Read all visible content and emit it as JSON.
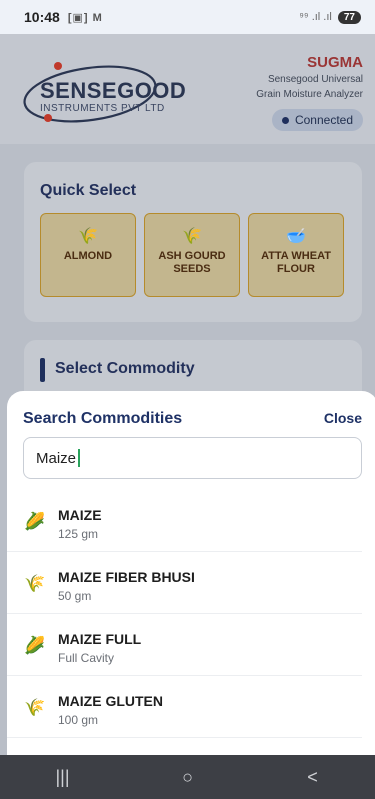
{
  "status_bar": {
    "time": "10:48",
    "left_icons": "[▣] M",
    "right_icons": "⁹⁹ .ıl .ıl",
    "battery": "77"
  },
  "header": {
    "brand": "SENSEGOOD",
    "brand_sub": "INSTRUMENTS PVT LTD",
    "title": "SUGMA",
    "desc_line1": "Sensegood Universal",
    "desc_line2": "Grain Moisture Analyzer",
    "status": "Connected"
  },
  "quick_select": {
    "title": "Quick Select",
    "items": [
      {
        "label_line1": "ALMOND",
        "label_line2": "",
        "icon": "🌾"
      },
      {
        "label_line1": "ASH GOURD",
        "label_line2": "SEEDS",
        "icon": "🌾"
      },
      {
        "label_line1": "ATTA WHEAT",
        "label_line2": "FLOUR",
        "icon": "🥣"
      }
    ]
  },
  "select_commodity": {
    "title": "Select Commodity"
  },
  "sheet": {
    "title": "Search Commodities",
    "close_label": "Close",
    "search_value": "Maize",
    "results": [
      {
        "name": "MAIZE",
        "sub": "125 gm",
        "icon": "🌽"
      },
      {
        "name": "MAIZE FIBER BHUSI",
        "sub": "50 gm",
        "icon": "🌾"
      },
      {
        "name": "MAIZE FULL",
        "sub": "Full Cavity",
        "icon": "🌽"
      },
      {
        "name": "MAIZE GLUTEN",
        "sub": "100 gm",
        "icon": "🌾"
      }
    ]
  },
  "navbar": {
    "recent": "|||",
    "home": "○",
    "back": "<"
  },
  "colors": {
    "accent_navy": "#1f3266",
    "brand_red": "#9a3535",
    "quick_select_tile": "#c3b68e"
  }
}
